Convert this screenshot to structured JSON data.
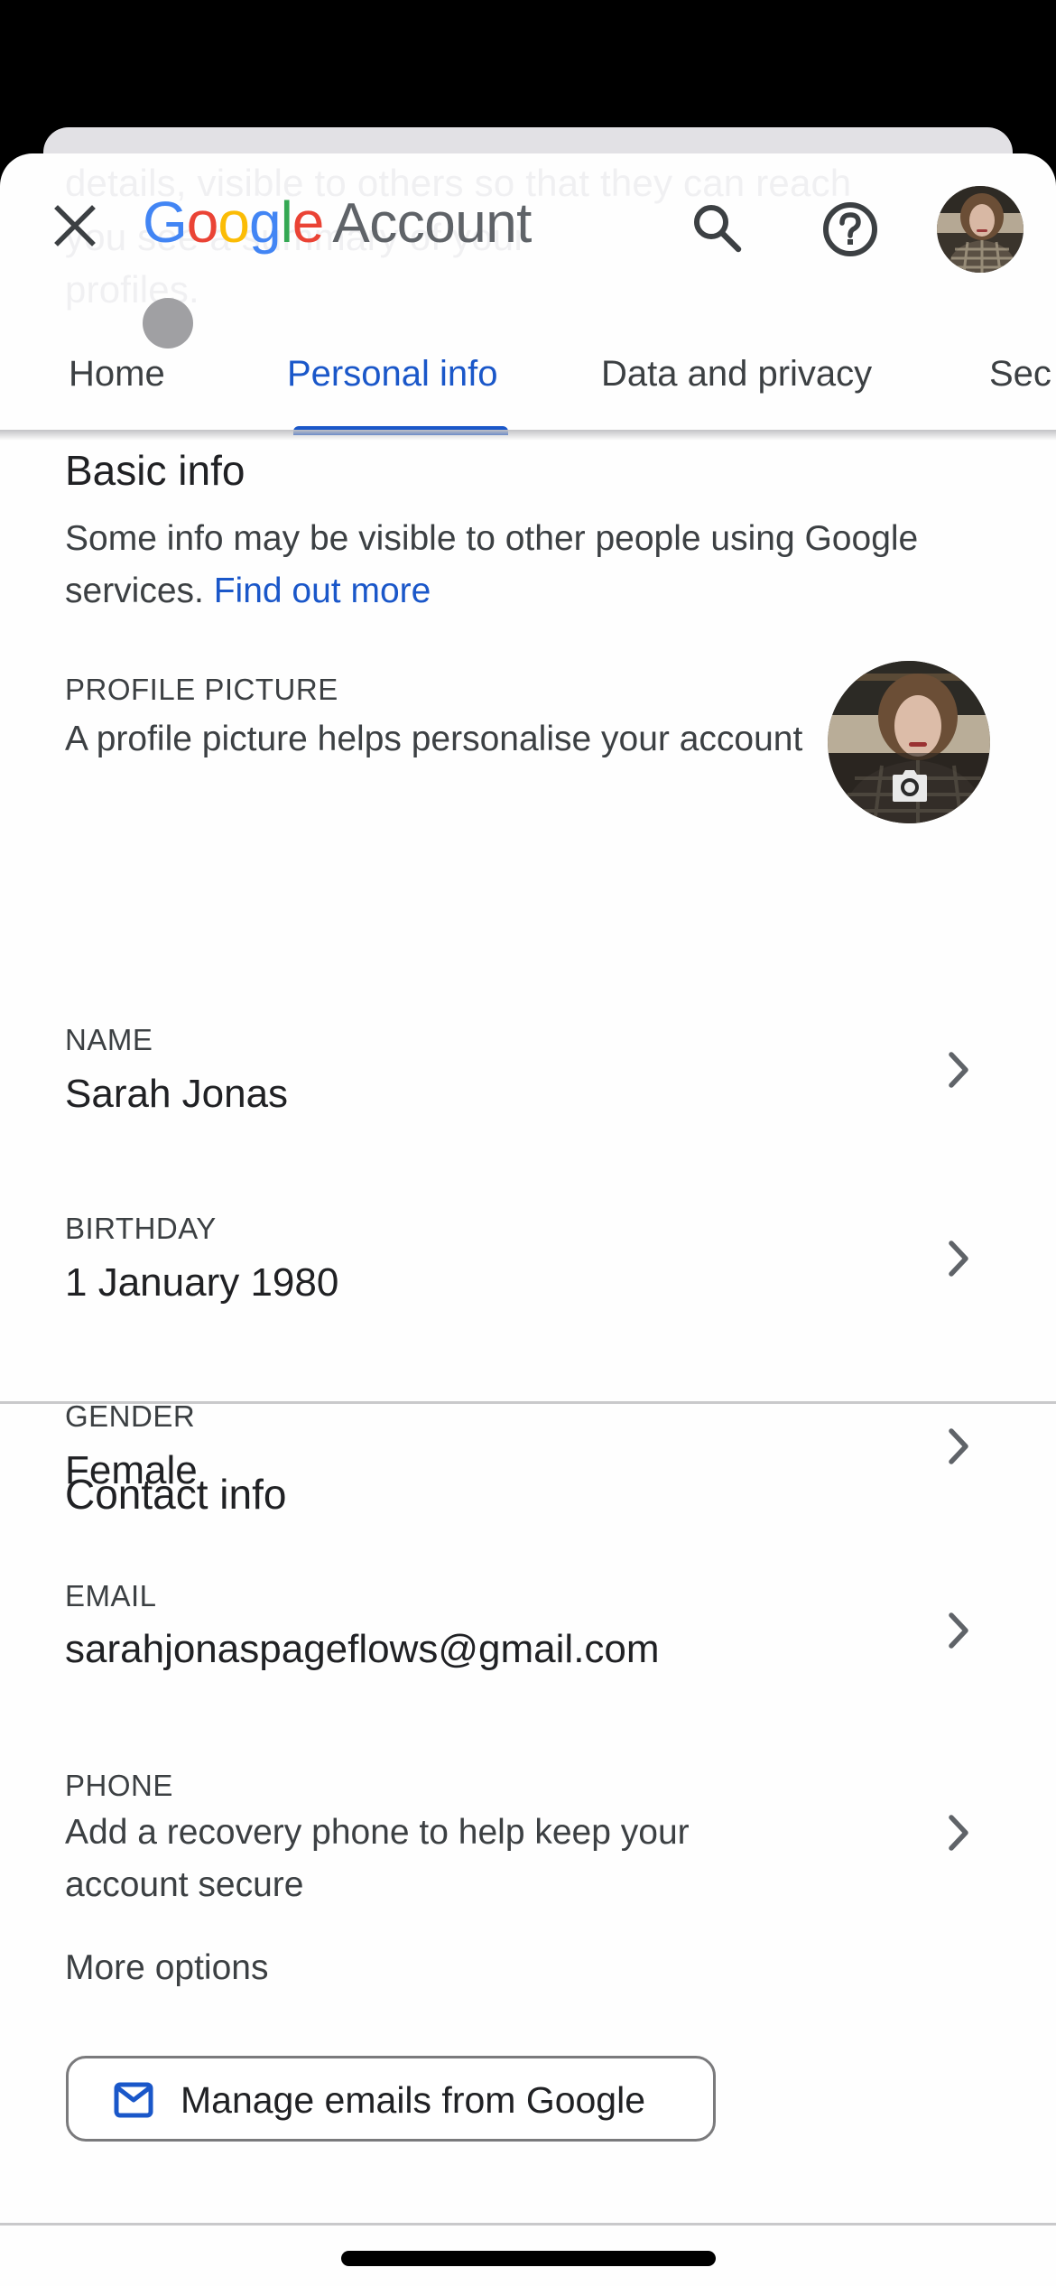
{
  "overlay": {
    "ghost_text": [
      "details, visible to others so that they can reach",
      "you                       see a summary of your",
      "profiles."
    ]
  },
  "header": {
    "logo": {
      "g1": "G",
      "o1": "o",
      "o2": "o",
      "g2": "g",
      "l": "l",
      "e": "e",
      "product": "Account"
    },
    "icons": {
      "close": "close-icon",
      "search": "search-icon",
      "help": "help-circle-icon",
      "avatar": "account-avatar"
    }
  },
  "tabs": [
    {
      "label": "Home",
      "active": false
    },
    {
      "label": "Personal info",
      "active": true
    },
    {
      "label": "Data and privacy",
      "active": false
    },
    {
      "label": "Sec",
      "active": false
    }
  ],
  "basic_info": {
    "title": "Basic info",
    "description": "Some info may be visible to other people using Google services.",
    "link": "Find out more",
    "profile_picture": {
      "label": "PROFILE PICTURE",
      "description": "A profile picture helps personalise your account",
      "icon": "camera-icon"
    },
    "name": {
      "label": "NAME",
      "value": "Sarah Jonas"
    },
    "birthday": {
      "label": "BIRTHDAY",
      "value": "1 January 1980"
    },
    "gender": {
      "label": "GENDER",
      "value": "Female"
    }
  },
  "contact_info": {
    "title": "Contact info",
    "email": {
      "label": "EMAIL",
      "value": "sarahjonaspageflows@gmail.com"
    },
    "phone": {
      "label": "PHONE",
      "value": "Add a recovery phone to help keep your account secure"
    },
    "more_options": "More options",
    "manage_button": {
      "label": "Manage emails from Google",
      "icon": "mail-icon"
    }
  },
  "colors": {
    "accent": "#1a57c9",
    "google_blue": "#4285f4",
    "google_red": "#ea4335",
    "google_yellow": "#fbbc05",
    "google_green": "#34a853",
    "text_primary": "#202124",
    "text_secondary": "#3c4043"
  }
}
